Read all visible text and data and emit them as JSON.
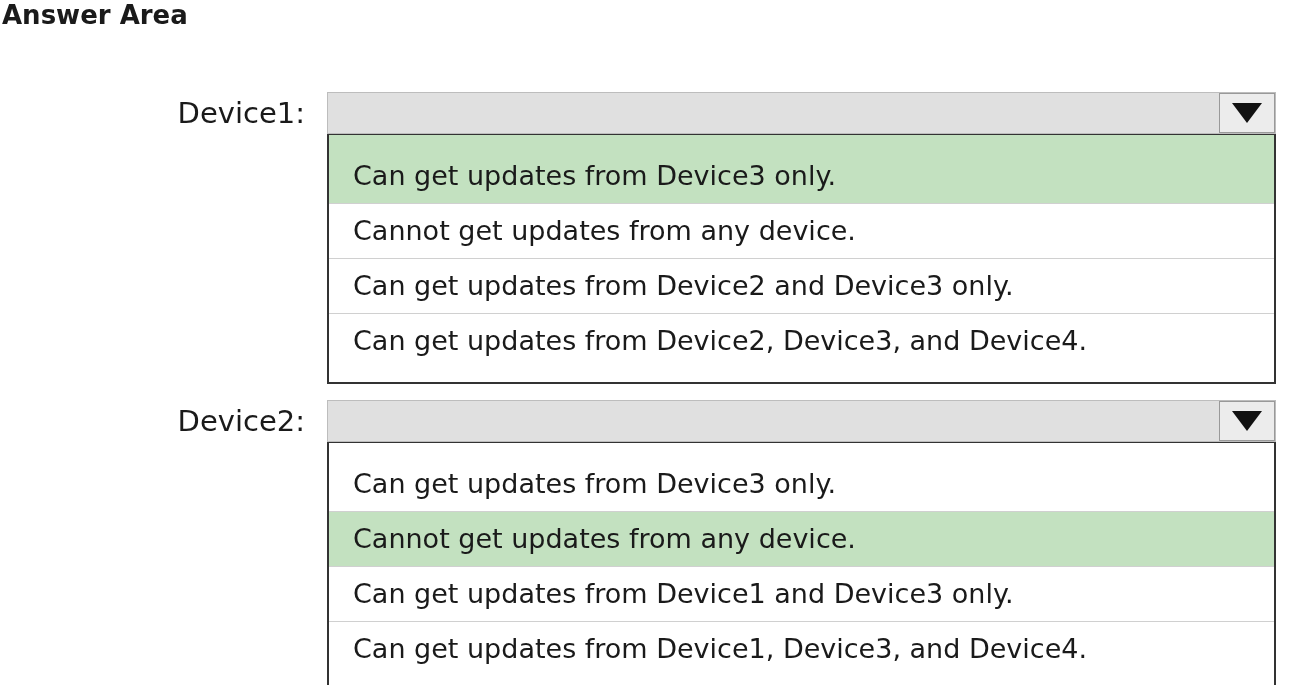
{
  "title": "Answer Area",
  "questions": [
    {
      "label": "Device1:",
      "options": [
        {
          "text": "Can get updates from Device3 only.",
          "selected": true
        },
        {
          "text": "Cannot get updates from any device.",
          "selected": false
        },
        {
          "text": "Can get updates from Device2 and Device3 only.",
          "selected": false
        },
        {
          "text": "Can get updates from Device2, Device3, and Device4.",
          "selected": false
        }
      ]
    },
    {
      "label": "Device2:",
      "options": [
        {
          "text": "Can get updates from Device3 only.",
          "selected": false
        },
        {
          "text": "Cannot get updates from any device.",
          "selected": true
        },
        {
          "text": "Can get updates from Device1 and Device3 only.",
          "selected": false
        },
        {
          "text": "Can get updates from Device1, Device3, and Device4.",
          "selected": false
        }
      ]
    }
  ]
}
